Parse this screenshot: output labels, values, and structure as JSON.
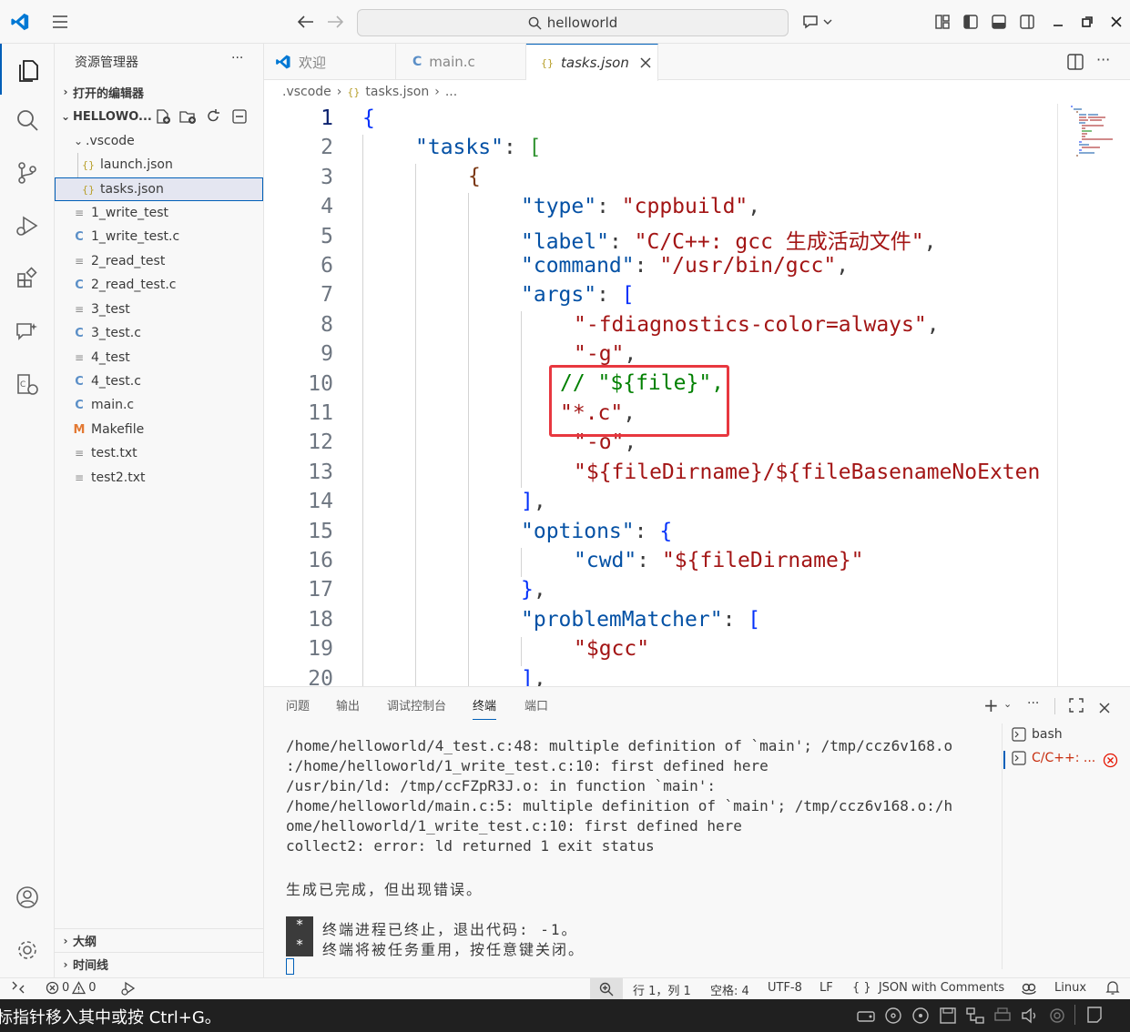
{
  "titlebar": {
    "search_text": "helloworld"
  },
  "sidebar": {
    "title": "资源管理器",
    "more": "···",
    "open_editors": "打开的编辑器",
    "folder": "HELLOWO...",
    "items": [
      {
        "label": ".vscode",
        "type": "folder"
      },
      {
        "label": "launch.json",
        "type": "json"
      },
      {
        "label": "tasks.json",
        "type": "json"
      },
      {
        "label": "1_write_test",
        "type": "txt"
      },
      {
        "label": "1_write_test.c",
        "type": "c"
      },
      {
        "label": "2_read_test",
        "type": "txt"
      },
      {
        "label": "2_read_test.c",
        "type": "c"
      },
      {
        "label": "3_test",
        "type": "txt"
      },
      {
        "label": "3_test.c",
        "type": "c"
      },
      {
        "label": "4_test",
        "type": "txt"
      },
      {
        "label": "4_test.c",
        "type": "c"
      },
      {
        "label": "main.c",
        "type": "c"
      },
      {
        "label": "Makefile",
        "type": "make"
      },
      {
        "label": "test.txt",
        "type": "txt"
      },
      {
        "label": "test2.txt",
        "type": "txt"
      }
    ],
    "outline": "大纲",
    "timeline": "时间线"
  },
  "tabs": [
    {
      "label": "欢迎"
    },
    {
      "label": "main.c"
    },
    {
      "label": "tasks.json"
    }
  ],
  "breadcrumb": {
    "folder": ".vscode",
    "file": "tasks.json",
    "more": "..."
  },
  "editor": {
    "line_numbers": [
      "1",
      "2",
      "3",
      "4",
      "5",
      "6",
      "7",
      "8",
      "9",
      "10",
      "11",
      "12",
      "13",
      "14",
      "15",
      "16",
      "17",
      "18",
      "19",
      "20"
    ],
    "code": {
      "l2_key": "\"tasks\"",
      "l4_key": "\"type\"",
      "l4_val": "\"cppbuild\"",
      "l5_key": "\"label\"",
      "l5_val": "\"C/C++: gcc 生成活动文件\"",
      "l6_key": "\"command\"",
      "l6_val": "\"/usr/bin/gcc\"",
      "l7_key": "\"args\"",
      "l8_val": "\"-fdiagnostics-color=always\"",
      "l9_val": "\"-g\"",
      "l10_comment": "// \"${file}\"",
      "l11_val": "\"*.c\"",
      "l12_val": "\"-o\"",
      "l13_val": "\"${fileDirname}/${fileBasenameNoExten",
      "l15_key": "\"options\"",
      "l16_key": "\"cwd\"",
      "l16_val": "\"${fileDirname}\"",
      "l18_key": "\"problemMatcher\"",
      "l19_val": "\"$gcc\""
    }
  },
  "panel": {
    "tabs": [
      "问题",
      "输出",
      "调试控制台",
      "终端",
      "端口"
    ],
    "terminal_lines": [
      "/home/helloworld/4_test.c:48: multiple definition of `main'; /tmp/ccz6v168.o",
      ":/home/helloworld/1_write_test.c:10: first defined here",
      "/usr/bin/ld: /tmp/ccFZpR3J.o: in function `main':",
      "/home/helloworld/main.c:5: multiple definition of `main'; /tmp/ccz6v168.o:/h",
      "ome/helloworld/1_write_test.c:10: first defined here",
      "collect2: error: ld returned 1 exit status"
    ],
    "build_msg": "生成已完成，但出现错误。",
    "mark": "*",
    "exit_msg": "终端进程已终止，退出代码: -1。",
    "reuse_msg": "终端将被任务重用，按任意键关闭。",
    "terminals": [
      {
        "label": "bash"
      },
      {
        "label": "C/C++: ..."
      }
    ]
  },
  "statusbar": {
    "errors": "0",
    "warnings": "0",
    "position": "行 1，列 1",
    "spaces": "空格: 4",
    "encoding": "UTF-8",
    "eol": "LF",
    "language": "JSON with Comments",
    "platform": "Linux"
  },
  "osbar": {
    "message": "标指针移入其中或按 Ctrl+G。"
  },
  "colors": {
    "accent": "#005fb8",
    "highlight_box": "#e8373f",
    "json_key": "#0451a5",
    "json_string": "#a31515",
    "comment": "#008000"
  }
}
